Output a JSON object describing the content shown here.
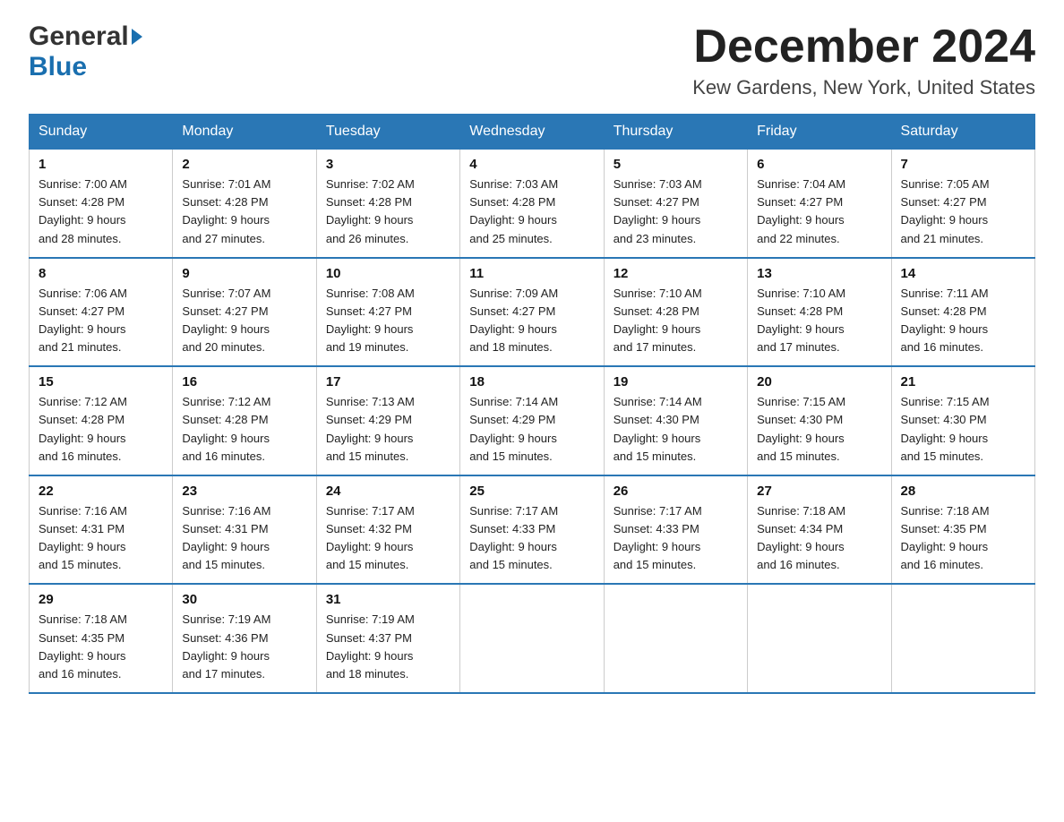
{
  "header": {
    "title": "December 2024",
    "subtitle": "Kew Gardens, New York, United States",
    "logo_general": "General",
    "logo_blue": "Blue"
  },
  "days_of_week": [
    "Sunday",
    "Monday",
    "Tuesday",
    "Wednesday",
    "Thursday",
    "Friday",
    "Saturday"
  ],
  "weeks": [
    [
      {
        "day": "1",
        "sunrise": "7:00 AM",
        "sunset": "4:28 PM",
        "daylight": "9 hours and 28 minutes."
      },
      {
        "day": "2",
        "sunrise": "7:01 AM",
        "sunset": "4:28 PM",
        "daylight": "9 hours and 27 minutes."
      },
      {
        "day": "3",
        "sunrise": "7:02 AM",
        "sunset": "4:28 PM",
        "daylight": "9 hours and 26 minutes."
      },
      {
        "day": "4",
        "sunrise": "7:03 AM",
        "sunset": "4:28 PM",
        "daylight": "9 hours and 25 minutes."
      },
      {
        "day": "5",
        "sunrise": "7:03 AM",
        "sunset": "4:27 PM",
        "daylight": "9 hours and 23 minutes."
      },
      {
        "day": "6",
        "sunrise": "7:04 AM",
        "sunset": "4:27 PM",
        "daylight": "9 hours and 22 minutes."
      },
      {
        "day": "7",
        "sunrise": "7:05 AM",
        "sunset": "4:27 PM",
        "daylight": "9 hours and 21 minutes."
      }
    ],
    [
      {
        "day": "8",
        "sunrise": "7:06 AM",
        "sunset": "4:27 PM",
        "daylight": "9 hours and 21 minutes."
      },
      {
        "day": "9",
        "sunrise": "7:07 AM",
        "sunset": "4:27 PM",
        "daylight": "9 hours and 20 minutes."
      },
      {
        "day": "10",
        "sunrise": "7:08 AM",
        "sunset": "4:27 PM",
        "daylight": "9 hours and 19 minutes."
      },
      {
        "day": "11",
        "sunrise": "7:09 AM",
        "sunset": "4:27 PM",
        "daylight": "9 hours and 18 minutes."
      },
      {
        "day": "12",
        "sunrise": "7:10 AM",
        "sunset": "4:28 PM",
        "daylight": "9 hours and 17 minutes."
      },
      {
        "day": "13",
        "sunrise": "7:10 AM",
        "sunset": "4:28 PM",
        "daylight": "9 hours and 17 minutes."
      },
      {
        "day": "14",
        "sunrise": "7:11 AM",
        "sunset": "4:28 PM",
        "daylight": "9 hours and 16 minutes."
      }
    ],
    [
      {
        "day": "15",
        "sunrise": "7:12 AM",
        "sunset": "4:28 PM",
        "daylight": "9 hours and 16 minutes."
      },
      {
        "day": "16",
        "sunrise": "7:12 AM",
        "sunset": "4:28 PM",
        "daylight": "9 hours and 16 minutes."
      },
      {
        "day": "17",
        "sunrise": "7:13 AM",
        "sunset": "4:29 PM",
        "daylight": "9 hours and 15 minutes."
      },
      {
        "day": "18",
        "sunrise": "7:14 AM",
        "sunset": "4:29 PM",
        "daylight": "9 hours and 15 minutes."
      },
      {
        "day": "19",
        "sunrise": "7:14 AM",
        "sunset": "4:30 PM",
        "daylight": "9 hours and 15 minutes."
      },
      {
        "day": "20",
        "sunrise": "7:15 AM",
        "sunset": "4:30 PM",
        "daylight": "9 hours and 15 minutes."
      },
      {
        "day": "21",
        "sunrise": "7:15 AM",
        "sunset": "4:30 PM",
        "daylight": "9 hours and 15 minutes."
      }
    ],
    [
      {
        "day": "22",
        "sunrise": "7:16 AM",
        "sunset": "4:31 PM",
        "daylight": "9 hours and 15 minutes."
      },
      {
        "day": "23",
        "sunrise": "7:16 AM",
        "sunset": "4:31 PM",
        "daylight": "9 hours and 15 minutes."
      },
      {
        "day": "24",
        "sunrise": "7:17 AM",
        "sunset": "4:32 PM",
        "daylight": "9 hours and 15 minutes."
      },
      {
        "day": "25",
        "sunrise": "7:17 AM",
        "sunset": "4:33 PM",
        "daylight": "9 hours and 15 minutes."
      },
      {
        "day": "26",
        "sunrise": "7:17 AM",
        "sunset": "4:33 PM",
        "daylight": "9 hours and 15 minutes."
      },
      {
        "day": "27",
        "sunrise": "7:18 AM",
        "sunset": "4:34 PM",
        "daylight": "9 hours and 16 minutes."
      },
      {
        "day": "28",
        "sunrise": "7:18 AM",
        "sunset": "4:35 PM",
        "daylight": "9 hours and 16 minutes."
      }
    ],
    [
      {
        "day": "29",
        "sunrise": "7:18 AM",
        "sunset": "4:35 PM",
        "daylight": "9 hours and 16 minutes."
      },
      {
        "day": "30",
        "sunrise": "7:19 AM",
        "sunset": "4:36 PM",
        "daylight": "9 hours and 17 minutes."
      },
      {
        "day": "31",
        "sunrise": "7:19 AM",
        "sunset": "4:37 PM",
        "daylight": "9 hours and 18 minutes."
      },
      null,
      null,
      null,
      null
    ]
  ],
  "labels": {
    "sunrise": "Sunrise:",
    "sunset": "Sunset:",
    "daylight": "Daylight:"
  }
}
